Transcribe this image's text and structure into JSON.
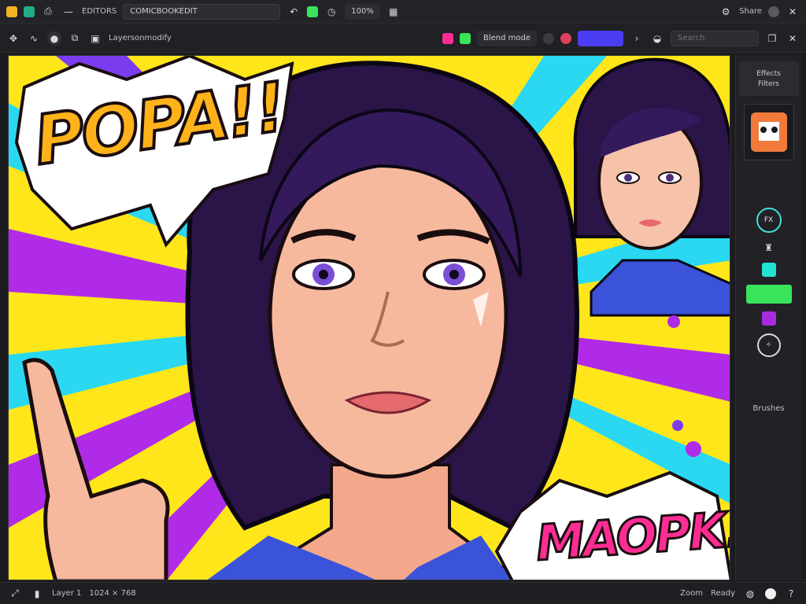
{
  "topbar": {
    "app_name": "EDITORS",
    "file_name": "COMICBOOKEDIT",
    "zoom_label": "100%",
    "user_label": "Share"
  },
  "toolbar": {
    "layer_label": "Layersonmodify",
    "blend_label": "Blend mode",
    "search_placeholder": "Search"
  },
  "comic": {
    "sfx_top": "POPA!!",
    "sfx_bottom": "MAOPK!"
  },
  "rightpanel": {
    "header_line1": "Effects",
    "header_line2": "Filters",
    "ring_label": "FX",
    "footer_label": "Brushes"
  },
  "status": {
    "left": "Layer 1",
    "middle": "1024 × 768",
    "zoom": "Zoom",
    "right": "Ready"
  },
  "colors": {
    "accent_blue": "#4a3df2",
    "pink": "#ff2d93",
    "green": "#39e35a",
    "teal": "#22e3d1",
    "purple": "#a92be0",
    "yellow": "#ffe61b"
  }
}
